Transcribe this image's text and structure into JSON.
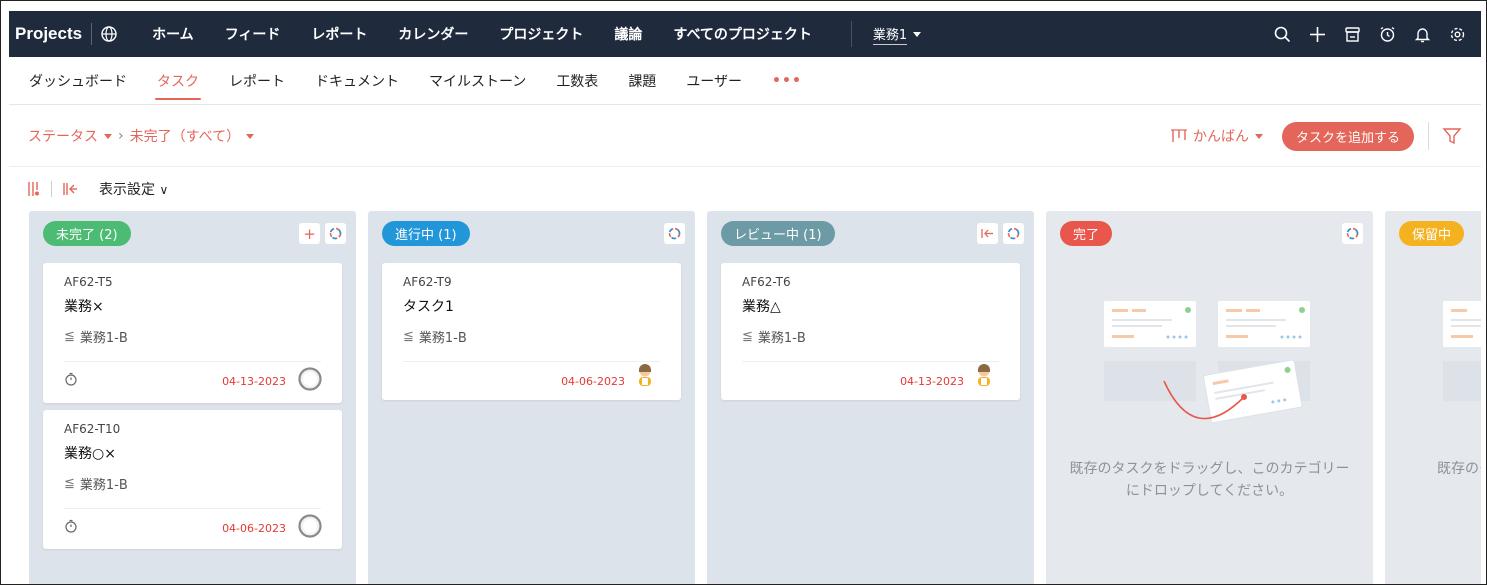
{
  "topbar": {
    "brand": "Projects",
    "nav": [
      "ホーム",
      "フィード",
      "レポート",
      "カレンダー",
      "プロジェクト",
      "議論",
      "すべてのプロジェクト"
    ],
    "project_selector": "業務1",
    "icons": [
      "search-icon",
      "plus-icon",
      "store-icon",
      "alarm-icon",
      "bell-icon",
      "gear-icon"
    ]
  },
  "subnav": {
    "items": [
      "ダッシュボード",
      "タスク",
      "レポート",
      "ドキュメント",
      "マイルストーン",
      "工数表",
      "課題",
      "ユーザー"
    ],
    "active": "タスク",
    "more": "•••"
  },
  "filterbar": {
    "status_label": "ステータス",
    "filter_value": "未完了（すべて）",
    "view_label": "かんばん",
    "add_task_label": "タスクを追加する"
  },
  "toolrow": {
    "display_settings": "表示設定"
  },
  "columns": [
    {
      "label": "未完了 (2)",
      "color": "#4cbb73",
      "cards": [
        {
          "id": "AF62-T5",
          "name": "業務×",
          "tasklist": "業務1-B",
          "date": "04-13-2023"
        },
        {
          "id": "AF62-T10",
          "name": "業務○×",
          "tasklist": "業務1-B",
          "date": "04-06-2023"
        }
      ]
    },
    {
      "label": "進行中 (1)",
      "color": "#2196d9",
      "cards": [
        {
          "id": "AF62-T9",
          "name": "タスク1",
          "tasklist": "業務1-B",
          "date": "04-06-2023"
        }
      ]
    },
    {
      "label": "レビュー中 (1)",
      "color": "#6c9aa5",
      "cards": [
        {
          "id": "AF62-T6",
          "name": "業務△",
          "tasklist": "業務1-B",
          "date": "04-13-2023"
        }
      ]
    },
    {
      "label": "完了",
      "color": "#e9564b",
      "empty_text": "既存のタスクをドラッグし、このカテゴリーにドロップしてください。"
    },
    {
      "label": "保留中",
      "color": "#f4b221",
      "empty_text": "既存のタスクをドラッグし、このカテゴリーにドロップしてください。"
    }
  ],
  "colors": {
    "accent": "#e4665a",
    "topbar_bg": "#1f2a3d",
    "due_date": "#e53935"
  }
}
